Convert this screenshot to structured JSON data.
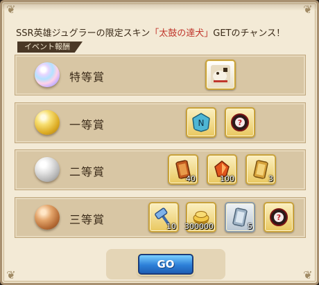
{
  "headline": {
    "prefix": "SSR英雄ジュグラーの限定スキン",
    "highlight": "「太鼓の達犬」",
    "suffix": "GETのチャンス！"
  },
  "section_tag": "イベント報酬",
  "tiers": [
    {
      "rank": "特等賞",
      "orb": "rainbow",
      "items": [
        {
          "name": "dog-skin-portrait-icon",
          "qty": ""
        }
      ]
    },
    {
      "rank": "一等賞",
      "orb": "gold",
      "items": [
        {
          "name": "rune-stone-icon",
          "qty": ""
        },
        {
          "name": "mystery-hero-icon",
          "qty": ""
        }
      ]
    },
    {
      "rank": "二等賞",
      "orb": "silver",
      "items": [
        {
          "name": "summon-card-icon",
          "qty": "40"
        },
        {
          "name": "fire-crystal-icon",
          "qty": "100"
        },
        {
          "name": "gold-card-icon",
          "qty": "3"
        }
      ]
    },
    {
      "rank": "三等賞",
      "orb": "bronze",
      "items": [
        {
          "name": "blue-hammer-icon",
          "qty": "10"
        },
        {
          "name": "gold-coins-icon",
          "qty": "300000"
        },
        {
          "name": "silver-card-icon",
          "qty": "5"
        },
        {
          "name": "mystery-hero-icon",
          "qty": ""
        }
      ]
    }
  ],
  "go_button": "GO"
}
